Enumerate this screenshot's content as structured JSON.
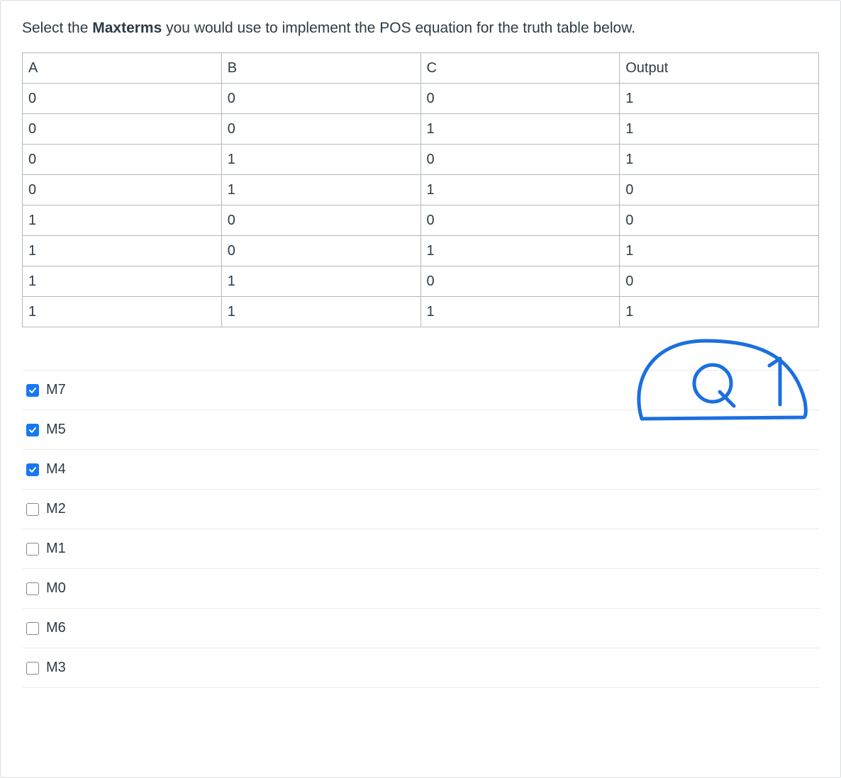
{
  "prompt": {
    "pre": "Select the ",
    "bold": "Maxterms",
    "post": " you would use to implement the POS equation for the truth table below."
  },
  "table": {
    "headers": [
      "A",
      "B",
      "C",
      "Output"
    ],
    "rows": [
      [
        "0",
        "0",
        "0",
        "1"
      ],
      [
        "0",
        "0",
        "1",
        "1"
      ],
      [
        "0",
        "1",
        "0",
        "1"
      ],
      [
        "0",
        "1",
        "1",
        "0"
      ],
      [
        "1",
        "0",
        "0",
        "0"
      ],
      [
        "1",
        "0",
        "1",
        "1"
      ],
      [
        "1",
        "1",
        "0",
        "0"
      ],
      [
        "1",
        "1",
        "1",
        "1"
      ]
    ]
  },
  "options": [
    {
      "label": "M7",
      "checked": true
    },
    {
      "label": "M5",
      "checked": true
    },
    {
      "label": "M4",
      "checked": true
    },
    {
      "label": "M2",
      "checked": false
    },
    {
      "label": "M1",
      "checked": false
    },
    {
      "label": "M0",
      "checked": false
    },
    {
      "label": "M6",
      "checked": false
    },
    {
      "label": "M3",
      "checked": false
    }
  ],
  "annotation_label": "Q1"
}
